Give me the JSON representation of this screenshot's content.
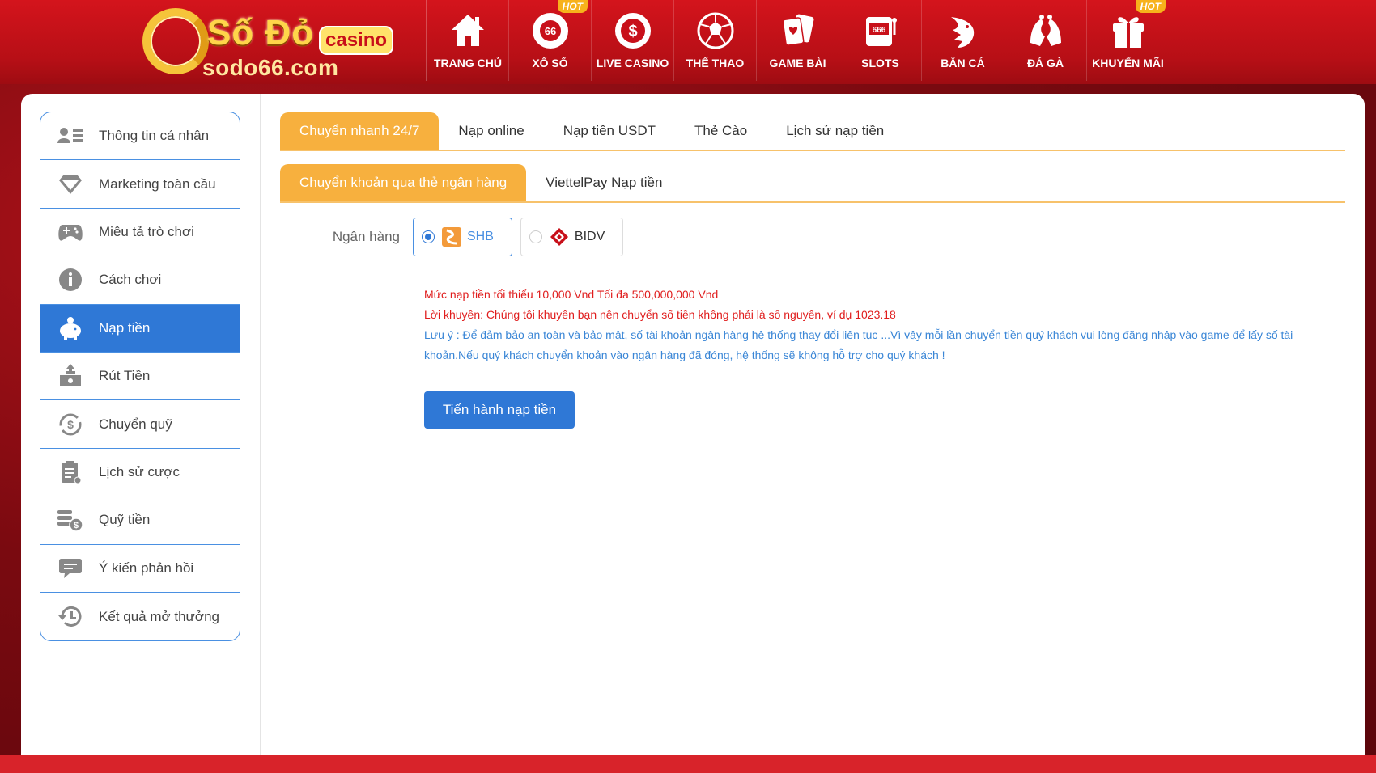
{
  "brand": {
    "logo_main": "Số Đỏ",
    "logo_casino": "casino",
    "logo_domain": "sodo66.com"
  },
  "nav": {
    "items": [
      {
        "label": "TRANG CHỦ",
        "icon": "home-icon",
        "hot": ""
      },
      {
        "label": "XỔ SỐ",
        "icon": "lottery-ball-icon",
        "hot": "HOT",
        "ball_text": "66"
      },
      {
        "label": "LIVE CASINO",
        "icon": "dollar-coin-icon",
        "hot": ""
      },
      {
        "label": "THỂ THAO",
        "icon": "soccer-ball-icon",
        "hot": ""
      },
      {
        "label": "GAME BÀI",
        "icon": "playing-cards-icon",
        "hot": ""
      },
      {
        "label": "SLOTS",
        "icon": "slot-machine-icon",
        "hot": "",
        "slot_text": "666"
      },
      {
        "label": "BẮN CÁ",
        "icon": "shark-icon",
        "hot": ""
      },
      {
        "label": "ĐÁ GÀ",
        "icon": "rooster-icon",
        "hot": ""
      },
      {
        "label": "KHUYẾN MÃI",
        "icon": "gift-icon",
        "hot": "HOT"
      }
    ]
  },
  "sidebar": {
    "items": [
      {
        "label": "Thông tin cá nhân",
        "icon": "profile-card-icon"
      },
      {
        "label": "Marketing toàn cầu",
        "icon": "diamond-icon"
      },
      {
        "label": "Miêu tả trò chơi",
        "icon": "gamepad-icon"
      },
      {
        "label": "Cách chơi",
        "icon": "info-icon"
      },
      {
        "label": "Nạp tiền",
        "icon": "piggy-bank-icon",
        "active": true
      },
      {
        "label": "Rút Tiền",
        "icon": "withdraw-icon"
      },
      {
        "label": "Chuyển quỹ",
        "icon": "transfer-coin-icon"
      },
      {
        "label": "Lịch sử cược",
        "icon": "clipboard-icon"
      },
      {
        "label": "Quỹ tiền",
        "icon": "coin-stack-icon"
      },
      {
        "label": "Ý kiến phản hồi",
        "icon": "chat-bubble-icon"
      },
      {
        "label": "Kết quả mở thưởng",
        "icon": "history-clock-icon"
      }
    ]
  },
  "tabs_primary": [
    "Chuyển nhanh 24/7",
    "Nạp online",
    "Nạp tiền USDT",
    "Thẻ Cào",
    "Lịch sử nạp tiền"
  ],
  "tabs_secondary": [
    "Chuyển khoản qua thẻ ngân hàng",
    "ViettelPay Nạp tiền"
  ],
  "bank": {
    "label": "Ngân hàng",
    "options": [
      {
        "name": "SHB",
        "selected": true
      },
      {
        "name": "BIDV",
        "selected": false
      }
    ]
  },
  "notes": {
    "limit": "Mức nạp tiền tối thiểu 10,000 Vnd Tối đa 500,000,000 Vnd",
    "advice": "Lời khuyên: Chúng tôi khuyên bạn nên chuyển số tiền không phải là số nguyên, ví dụ 1023.18",
    "warning": "Lưu ý : Để đảm bảo an toàn và bảo mật, số tài khoản ngân hàng hệ thống thay đổi liên tục ...Vì vậy mỗi lần chuyển tiền quý khách vui lòng đăng nhập vào game để lấy số tài khoản.Nếu quý khách chuyển khoản vào ngân hàng đã đóng, hệ thống sẽ không hỗ trợ cho quý khách !"
  },
  "submit_label": "Tiến hành nạp tiền",
  "colors": {
    "header_red": "#c8101a",
    "accent_orange": "#f7b03e",
    "primary_blue": "#2f78d6",
    "note_red": "#e01d1d",
    "note_blue": "#3a86d6"
  }
}
